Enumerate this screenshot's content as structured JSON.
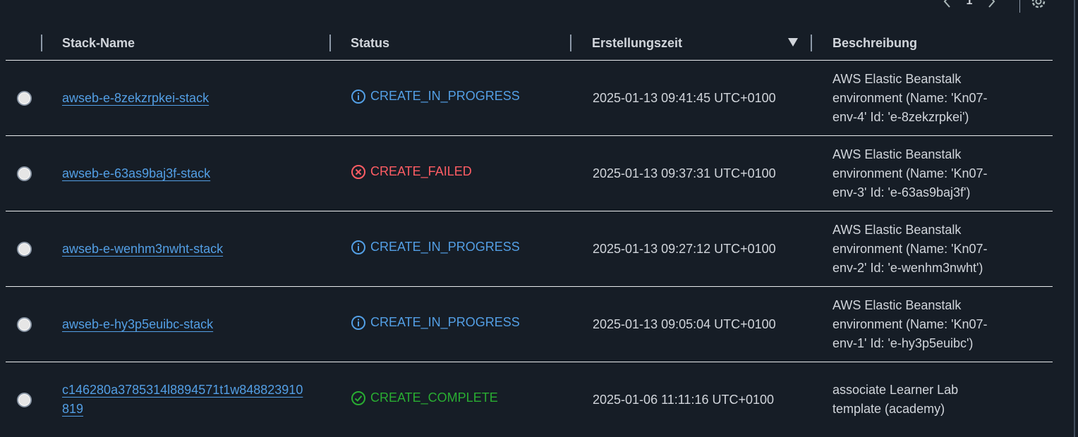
{
  "pagination": {
    "prev_icon": "chevron-left-icon",
    "page": "1",
    "next_icon": "chevron-right-icon",
    "settings_icon": "gear-icon"
  },
  "table": {
    "headers": {
      "name": "Stack-Name",
      "status": "Status",
      "created": "Erstellungszeit",
      "description": "Beschreibung"
    },
    "rows": [
      {
        "name": "awseb-e-8zekzrpkei-stack",
        "status": "CREATE_IN_PROGRESS",
        "status_type": "info",
        "created": "2025-01-13 09:41:45 UTC+0100",
        "description": "AWS Elastic Beanstalk environment (Name: 'Kn07-env-4' Id: 'e-8zekzrpkei')"
      },
      {
        "name": "awseb-e-63as9baj3f-stack",
        "status": "CREATE_FAILED",
        "status_type": "error",
        "created": "2025-01-13 09:37:31 UTC+0100",
        "description": "AWS Elastic Beanstalk environment (Name: 'Kn07-env-3' Id: 'e-63as9baj3f')"
      },
      {
        "name": "awseb-e-wenhm3nwht-stack",
        "status": "CREATE_IN_PROGRESS",
        "status_type": "info",
        "created": "2025-01-13 09:27:12 UTC+0100",
        "description": "AWS Elastic Beanstalk environment (Name: 'Kn07-env-2' Id: 'e-wenhm3nwht')"
      },
      {
        "name": "awseb-e-hy3p5euibc-stack",
        "status": "CREATE_IN_PROGRESS",
        "status_type": "info",
        "created": "2025-01-13 09:05:04 UTC+0100",
        "description": "AWS Elastic Beanstalk environment (Name: 'Kn07-env-1' Id: 'e-hy3p5euibc')"
      },
      {
        "name": "c146280a3785314l8894571t1w848823910819",
        "status": "CREATE_COMPLETE",
        "status_type": "success",
        "created": "2025-01-06 11:11:16 UTC+0100",
        "description": "associate Learner Lab template (academy)"
      }
    ]
  },
  "colors": {
    "background": "#161d26",
    "text": "#d1d5db",
    "link": "#539fe5",
    "info": "#539fe5",
    "error": "#ff5d64",
    "success": "#29ad32",
    "divider": "#e9ebed"
  }
}
